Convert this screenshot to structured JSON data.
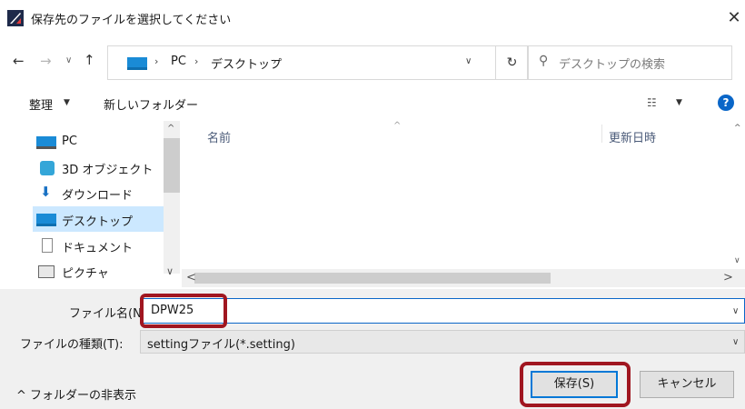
{
  "window": {
    "title": "保存先のファイルを選択してください",
    "close_glyph": "✕"
  },
  "nav": {
    "back_glyph": "←",
    "forward_glyph": "→",
    "recent_glyph": "∨",
    "up_glyph": "↑",
    "breadcrumb": [
      "PC",
      "デスクトップ"
    ],
    "separator": "›",
    "dropdown_glyph": "∨",
    "refresh_glyph": "↻",
    "search_placeholder": "デスクトップの検索",
    "search_glyph": "⚲"
  },
  "toolbar": {
    "organize_label": "整理",
    "organize_arrow": "▼",
    "new_folder_label": "新しいフォルダー",
    "view_glyph": "☷",
    "view_arrow": "▼",
    "help_glyph": "?"
  },
  "sidebar": {
    "items": [
      {
        "label": "PC",
        "icon": "pc-icon"
      },
      {
        "label": "3D オブジェクト",
        "icon": "3d-objects-icon"
      },
      {
        "label": "ダウンロード",
        "icon": "download-icon"
      },
      {
        "label": "デスクトップ",
        "icon": "desktop-icon",
        "selected": true
      },
      {
        "label": "ドキュメント",
        "icon": "document-icon"
      },
      {
        "label": "ピクチャ",
        "icon": "picture-icon"
      }
    ],
    "download_glyph": "⬇",
    "scroll_up_glyph": "^",
    "scroll_down_glyph": "∨"
  },
  "files": {
    "columns": [
      "名前",
      "更新日時"
    ],
    "sort_glyph": "^",
    "scroll_up_glyph": "^",
    "scroll_down_glyph": "∨",
    "hscroll_left_glyph": "<",
    "hscroll_right_glyph": ">"
  },
  "form": {
    "filename_label": "ファイル名(N):",
    "filename_value": "DPW25",
    "filetype_label": "ファイルの種類(T):",
    "filetype_value": "settingファイル(*.setting)",
    "dropdown_glyph": "∨"
  },
  "footer": {
    "toggle_folders_label": "^ フォルダーの非表示",
    "save_label": "保存(S)",
    "cancel_label": "キャンセル"
  },
  "colors": {
    "accent": "#0078d7",
    "highlight": "#a01620",
    "selection": "#cce8ff"
  }
}
